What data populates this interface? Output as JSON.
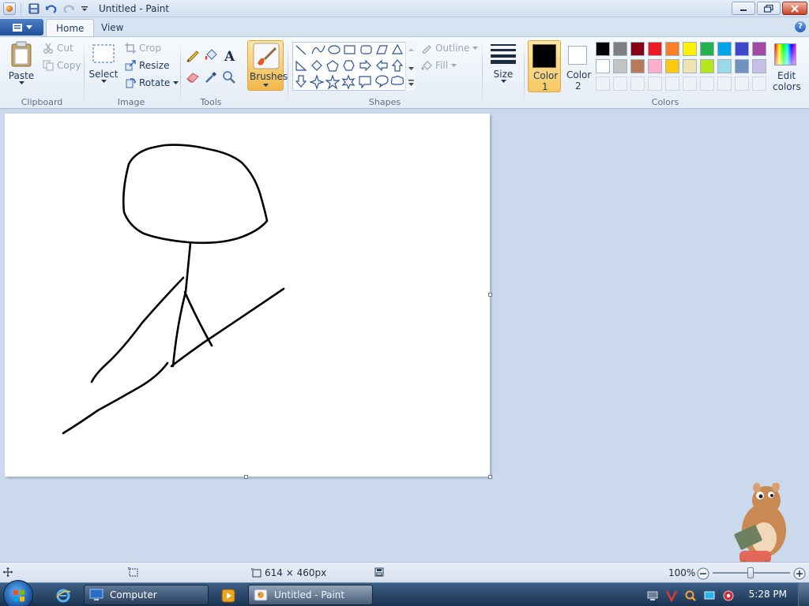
{
  "window": {
    "title": "Untitled - Paint"
  },
  "tabs": [
    {
      "label": "Home"
    },
    {
      "label": "View"
    }
  ],
  "clipboard": {
    "paste": "Paste",
    "cut": "Cut",
    "copy": "Copy",
    "group": "Clipboard"
  },
  "image": {
    "select": "Select",
    "crop": "Crop",
    "resize": "Resize",
    "rotate": "Rotate",
    "group": "Image"
  },
  "tools": {
    "group": "Tools",
    "brushes": "Brushes"
  },
  "shapes": {
    "outline": "Outline",
    "fill": "Fill",
    "group": "Shapes"
  },
  "size": {
    "label": "Size"
  },
  "colors": {
    "color1": "Color 1",
    "color1_line1": "Color",
    "color1_line2": "1",
    "color2_line1": "Color",
    "color2_line2": "2",
    "edit_line1": "Edit",
    "edit_line2": "colors",
    "group": "Colors",
    "selected1": "#000000",
    "selected2": "#ffffff",
    "palette_row1": [
      "#000000",
      "#7f7f7f",
      "#880015",
      "#ed1c24",
      "#ff7f27",
      "#fff200",
      "#22b14c",
      "#00a2e8",
      "#3f48cc",
      "#a349a4"
    ],
    "palette_row2": [
      "#ffffff",
      "#c3c3c3",
      "#b97a57",
      "#ffaec9",
      "#ffc90e",
      "#efe4b0",
      "#b5e61d",
      "#99d9ea",
      "#7092be",
      "#c8bfe7"
    ]
  },
  "status": {
    "dimensions": "614 × 460px",
    "zoom": "100%"
  },
  "taskbar": {
    "items": [
      {
        "label": "Computer"
      },
      {
        "label": "Untitled - Paint"
      }
    ],
    "clock": "5:28 PM"
  }
}
